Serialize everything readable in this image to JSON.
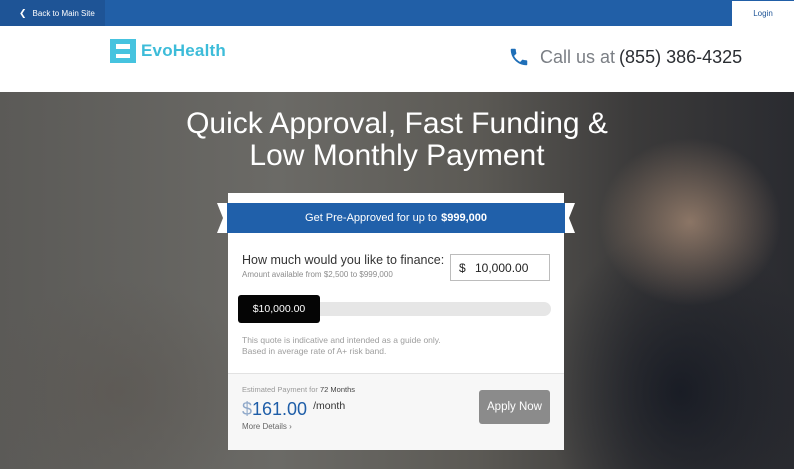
{
  "topbar": {
    "back_label": "Back to Main Site",
    "login_label": "Login"
  },
  "header": {
    "logo_text": "EvoHealth",
    "call_label": "Call us at",
    "phone_number": "(855) 386-4325"
  },
  "hero": {
    "title_line1": "Quick Approval, Fast Funding &",
    "title_line2": "Low Monthly Payment"
  },
  "calculator": {
    "banner_text": "Get Pre-Approved for up to",
    "banner_amount": "$999,000",
    "question": "How much would you like to finance:",
    "range_note": "Amount available from $2,500 to $999,000",
    "currency_symbol": "$",
    "amount_value": "10,000.00",
    "slider_label": "$10,000.00",
    "slider_level_fraction": 0.0076,
    "disclaimer_line1": "This quote is indicative and intended as a guide only.",
    "disclaimer_line2": "Based in average rate of A+ risk band.",
    "estimate_label": "Estimated Payment for",
    "estimate_term": "72 Months",
    "payment_symbol": "$",
    "payment_value": "161.00",
    "payment_period": "/month",
    "more_details": "More Details",
    "apply_label": "Apply Now"
  },
  "colors": {
    "brand_blue": "#215fa7",
    "logo_teal": "#3dbcd9",
    "apply_gray": "#8b8b8b"
  }
}
